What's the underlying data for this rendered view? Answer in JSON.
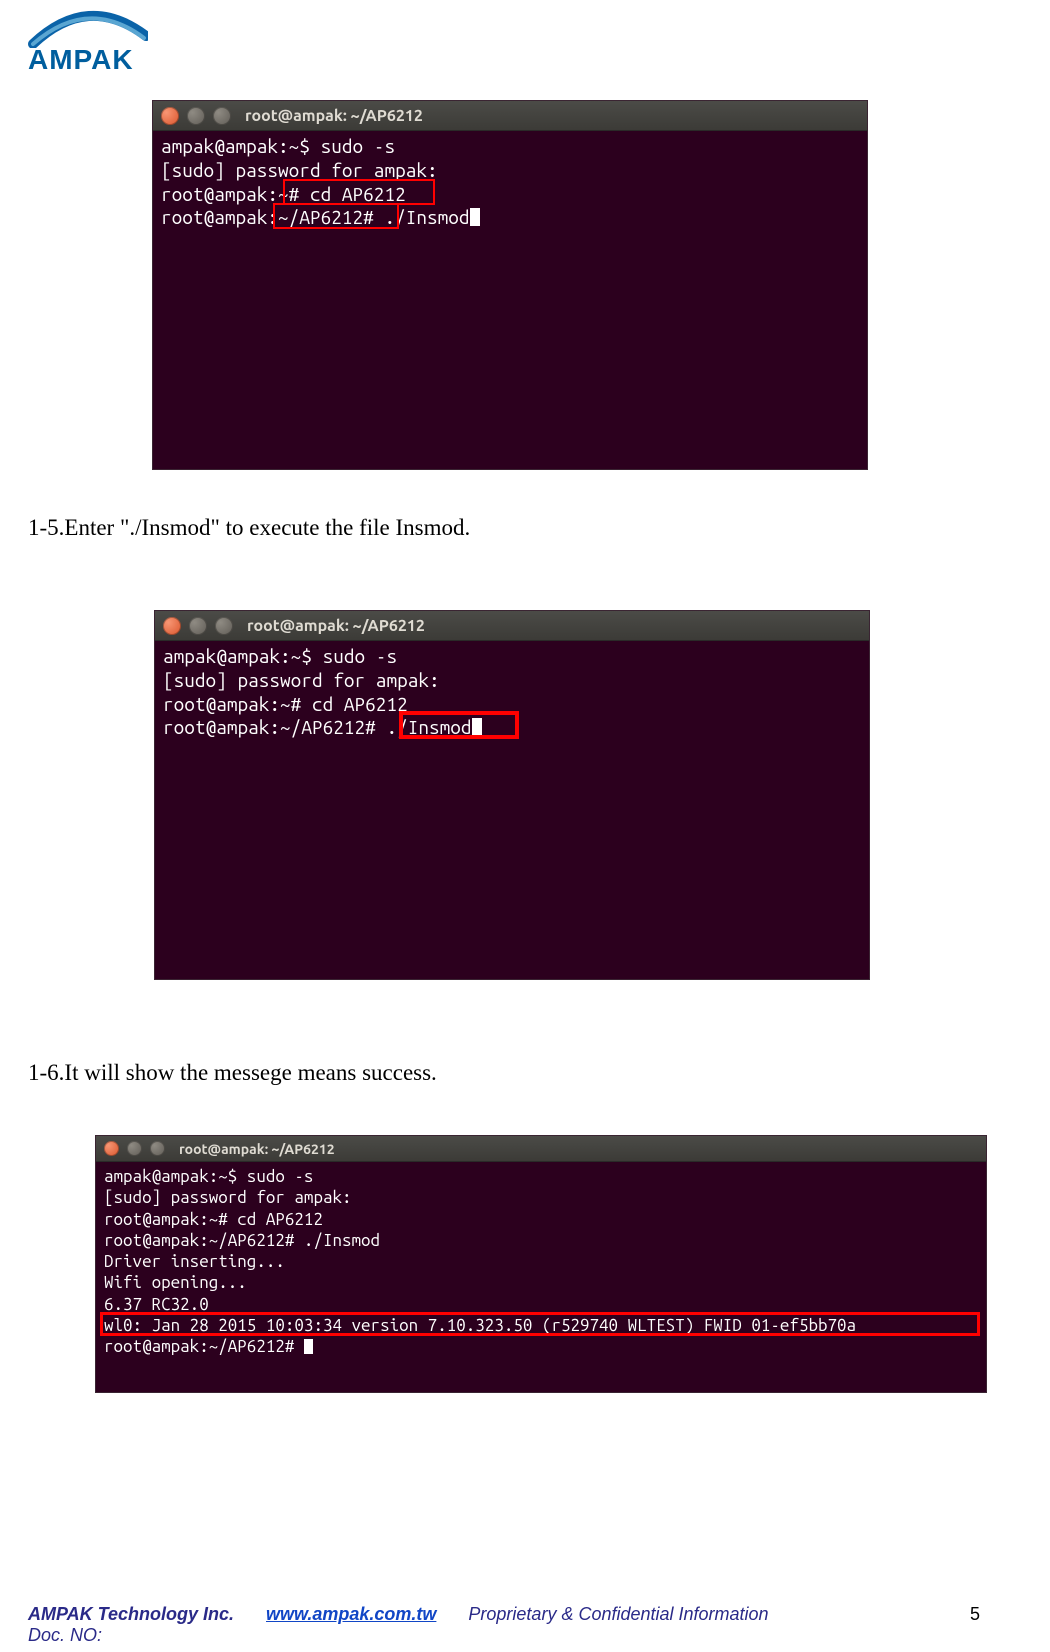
{
  "logo": {
    "text": "AMPAK"
  },
  "terminal1": {
    "title": "root@ampak: ~/AP6212",
    "lines": {
      "l1": "ampak@ampak:~$ sudo -s",
      "l2": "[sudo] password for ampak:",
      "l3_a": "root@ampak:",
      "l3_b": "~# cd AP6212",
      "l4_a": "root@ampak",
      "l4_b": ":~/AP6212#",
      "l4_c": " ./Insmod"
    }
  },
  "step15": "1-5.Enter \"./Insmod\" to execute the file Insmod.",
  "terminal2": {
    "title": "root@ampak: ~/AP6212",
    "lines": {
      "l1": "ampak@ampak:~$ sudo -s",
      "l2": "[sudo] password for ampak:",
      "l3": "root@ampak:~# cd AP6212",
      "l4_a": "root@ampak:~/AP6212# ",
      "l4_b": "./Insmod"
    }
  },
  "step16": "1-6.It will show the messege means success.",
  "terminal3": {
    "title": "root@ampak: ~/AP6212",
    "lines": {
      "l1": "ampak@ampak:~$ sudo -s",
      "l2": "[sudo] password for ampak:",
      "l3": "root@ampak:~# cd AP6212",
      "l4": "root@ampak:~/AP6212# ./Insmod",
      "l5": "Driver inserting...",
      "l6": "Wifi opening...",
      "l7": "6.37 RC32.0",
      "l8": "wl0: Jan 28 2015 10:03:34 version 7.10.323.50 (r529740 WLTEST) FWID 01-ef5bb70a",
      "l9": "root@ampak:~/AP6212# "
    }
  },
  "footer": {
    "company": "AMPAK Technology Inc.",
    "url": "www.ampak.com.tw",
    "prop": "Proprietary & Confidential Information",
    "page": "5",
    "docno": "Doc. NO:"
  }
}
